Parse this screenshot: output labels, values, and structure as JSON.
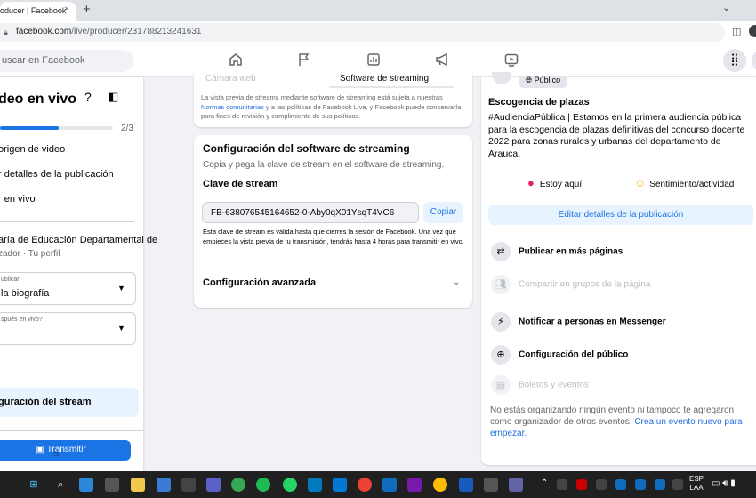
{
  "browser": {
    "tab_title": "oducer | Facebook",
    "tab_close": "×",
    "new_tab": "+",
    "window_control": "⌄",
    "url_host": "facebook.com",
    "url_path": "/live/producer/231788213241631"
  },
  "fb_header": {
    "search_placeholder": "uscar en Facebook",
    "nav_icons": [
      "home-icon",
      "flag-icon",
      "dashboard-icon",
      "megaphone-icon",
      "video-icon"
    ]
  },
  "left_panel": {
    "title": "deo en vivo",
    "progress_fraction": 0.52,
    "progress_label": "2/3",
    "steps": [
      "origen de video",
      "r detalles de la publicación",
      "r en vivo"
    ],
    "organizer_name": "aría de Educación Departamental de",
    "organizer_role": "zador · Tu perfil",
    "select_publish": {
      "label": "ublicar",
      "value": "la biografía"
    },
    "select_after_live": {
      "label": "spués en vivo?",
      "value": ""
    },
    "stream_config_label": "guración del stream",
    "go_live_label": "Transmitir"
  },
  "software_card": {
    "tab_camera": "Cámara web",
    "tab_software": "Software de streaming",
    "note_prefix": "La vista previa de streams mediante software de streaming está sujeta a nuestras",
    "note_link": "Normas comunitarias",
    "note_suffix": "y a las políticas de Facebook Live, y Facebook puede conservarla para fines de revisión y cumplimiento de sus políticas."
  },
  "config_card": {
    "title": "Configuración del software de streaming",
    "subtitle": "Copia y pega la clave de stream en el software de streaming.",
    "key_title": "Clave de stream",
    "stream_key": "FB-638076545164652-0-Aby0qX01YsqT4VC6",
    "copy_label": "Copiar",
    "key_note": "Esta clave de stream es válida hasta que cierres la sesión de Facebook. Una vez que empieces la vista previa de tu transmisión, tendrás hasta 4 horas para transmitir en vivo.",
    "advanced_label": "Configuración avanzada"
  },
  "right_panel": {
    "audience_chip": "Público",
    "post_title": "Escogencia de plazas",
    "post_body": "#AudienciaPública | Estamos en la primera audiencia pública para la escogencia de plazas definitivas del concurso docente 2022 para zonas rurales y urbanas del departamento de Arauca.",
    "here_label": "Estoy aquí",
    "feeling_label": "Sentimiento/actividad",
    "edit_label": "Editar detalles de la publicación",
    "options": [
      {
        "label": "Publicar en más páginas",
        "icon": "share-pages-icon",
        "enabled": true
      },
      {
        "label": "Compartir en grupos de la página",
        "icon": "groups-icon",
        "enabled": false
      },
      {
        "label": "Notificar a personas en Messenger",
        "icon": "messenger-icon",
        "enabled": true
      },
      {
        "label": "Configuración del público",
        "icon": "globe-icon",
        "enabled": true
      },
      {
        "label": "Boletos y eventos",
        "icon": "tickets-icon",
        "enabled": false
      }
    ],
    "events_note": "No estás organizando ningún evento ni tampoco te agregaron como organizador de otros eventos.",
    "events_link": "Crea un evento nuevo para empezar."
  },
  "taskbar": {
    "language_top": "ESP",
    "language_bottom": "LAA"
  },
  "colors": {
    "fb_blue": "#1b74e4",
    "light_blue": "#e7f3ff",
    "taskbar": "#202020"
  }
}
